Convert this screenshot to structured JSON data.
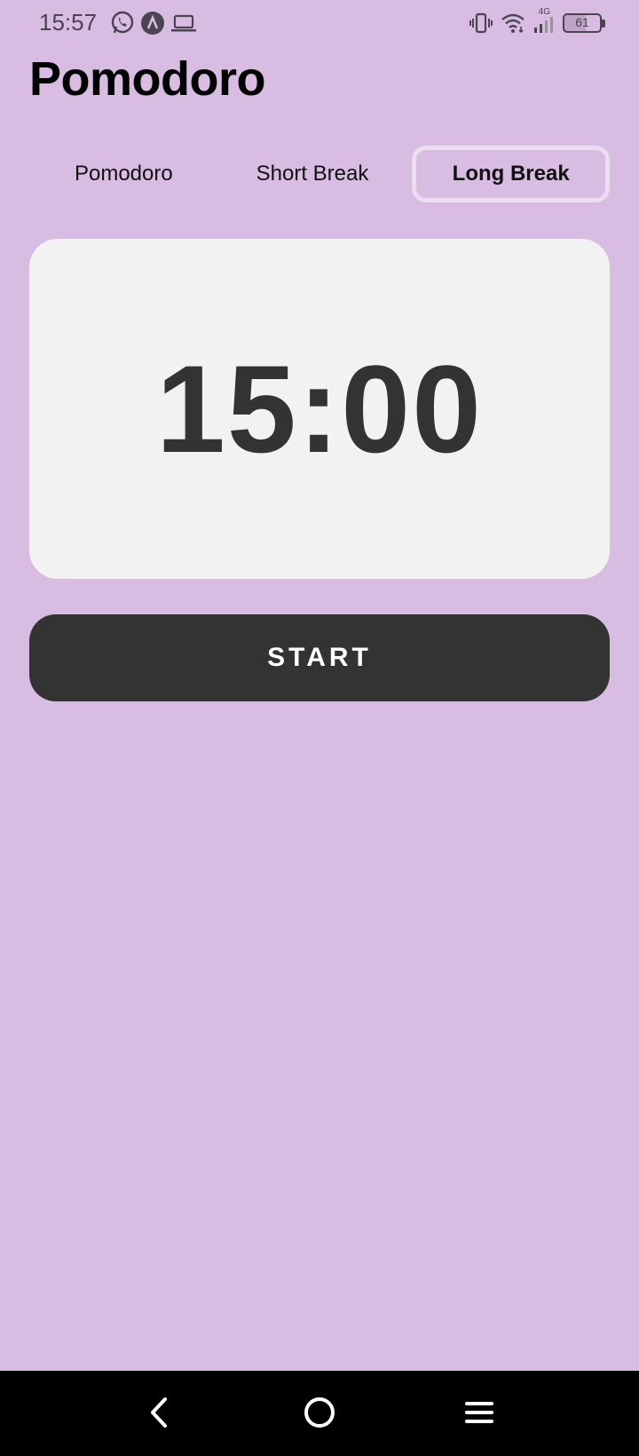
{
  "status_bar": {
    "time": "15:57",
    "network_label": "4G",
    "battery_level": "61",
    "battery_fraction": 0.61,
    "left_icons": [
      "whatsapp-icon",
      "app-notification-icon",
      "laptop-icon"
    ],
    "right_icons": [
      "vibrate-icon",
      "wifi-icon",
      "cell-signal-icon",
      "battery-icon"
    ]
  },
  "page": {
    "title": "Pomodoro"
  },
  "tabs": [
    {
      "label": "Pomodoro",
      "active": false
    },
    {
      "label": "Short Break",
      "active": false
    },
    {
      "label": "Long Break",
      "active": true
    }
  ],
  "timer": {
    "display": "15:00"
  },
  "actions": {
    "start_label": "START"
  },
  "nav_bar": {
    "buttons": [
      "back-icon",
      "home-icon",
      "menu-icon"
    ]
  },
  "colors": {
    "background": "#D8BCE2",
    "card": "#F2F2F2",
    "timer_text": "#333333",
    "button": "#333333",
    "button_text": "#FFFFFF",
    "active_tab_border": "#EBDDF0"
  }
}
